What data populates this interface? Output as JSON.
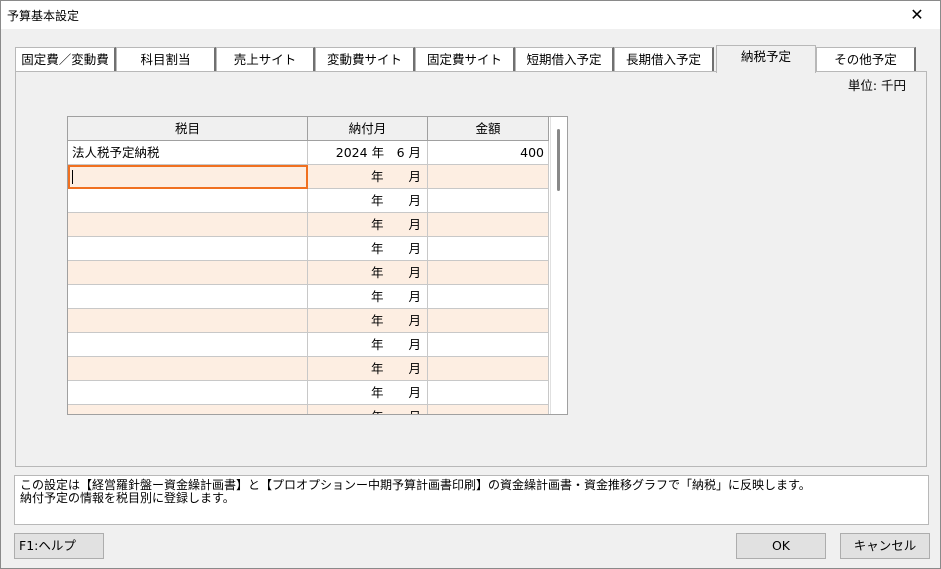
{
  "window": {
    "title": "予算基本設定",
    "close_glyph": "✕"
  },
  "tabs": [
    {
      "label": "固定費／変動費",
      "active": false
    },
    {
      "label": "科目割当",
      "active": false
    },
    {
      "label": "売上サイト",
      "active": false
    },
    {
      "label": "変動費サイト",
      "active": false
    },
    {
      "label": "固定費サイト",
      "active": false
    },
    {
      "label": "短期借入予定",
      "active": false
    },
    {
      "label": "長期借入予定",
      "active": false
    },
    {
      "label": "納税予定",
      "active": true
    },
    {
      "label": "その他予定",
      "active": false
    }
  ],
  "panel": {
    "unit": "単位: 千円"
  },
  "grid": {
    "columns": [
      "税目",
      "納付月",
      "金額"
    ],
    "rows": [
      {
        "tax": "法人税予定納税",
        "month": "2024 年　6 月",
        "amount": "400"
      },
      {
        "tax": "",
        "month": "年　　月",
        "amount": ""
      },
      {
        "tax": "",
        "month": "年　　月",
        "amount": ""
      },
      {
        "tax": "",
        "month": "年　　月",
        "amount": ""
      },
      {
        "tax": "",
        "month": "年　　月",
        "amount": ""
      },
      {
        "tax": "",
        "month": "年　　月",
        "amount": ""
      },
      {
        "tax": "",
        "month": "年　　月",
        "amount": ""
      },
      {
        "tax": "",
        "month": "年　　月",
        "amount": ""
      },
      {
        "tax": "",
        "month": "年　　月",
        "amount": ""
      },
      {
        "tax": "",
        "month": "年　　月",
        "amount": ""
      },
      {
        "tax": "",
        "month": "年　　月",
        "amount": ""
      },
      {
        "tax": "",
        "month": "年　　月",
        "amount": ""
      }
    ]
  },
  "description": {
    "line1": "この設定は【経営羅針盤ー資金繰計画書】と【プロオプションー中期予算計画書印刷】の資金繰計画書・資金推移グラフで「納税」に反映します。",
    "line2": "納付予定の情報を税目別に登録します。"
  },
  "buttons": {
    "help": "F1:ヘルプ",
    "ok": "OK",
    "cancel": "キャンセル"
  },
  "colors": {
    "focus": "#f07020",
    "alt_row": "#fdeee2"
  }
}
